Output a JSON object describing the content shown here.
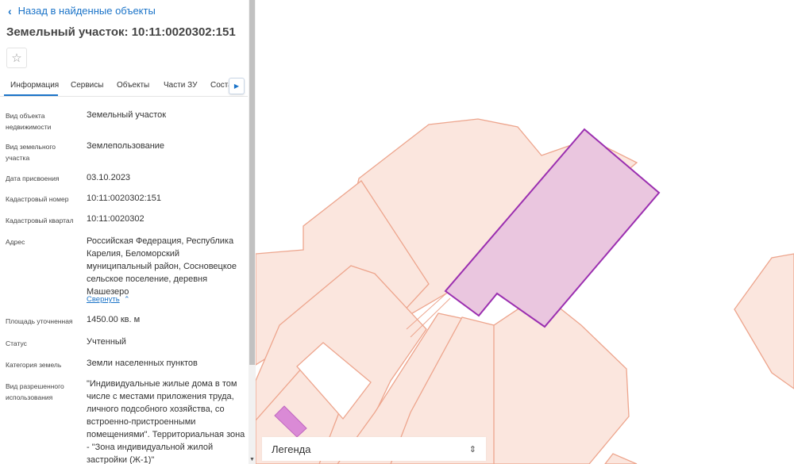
{
  "panel": {
    "back_label": "Назад в найденные объекты",
    "title": "Земельный участок: 10:11:0020302:151",
    "tabs": [
      {
        "label": "Информация"
      },
      {
        "label": "Сервисы"
      },
      {
        "label": "Объекты"
      },
      {
        "label": "Части ЗУ"
      },
      {
        "label": "Соста"
      }
    ],
    "collapse_label": "Свернуть",
    "rows": [
      {
        "label": "Вид объекта недвижимости",
        "value": "Земельный участок"
      },
      {
        "label": "Вид земельного участка",
        "value": "Землепользование"
      },
      {
        "label": "Дата присвоения",
        "value": "03.10.2023"
      },
      {
        "label": "Кадастровый номер",
        "value": "10:11:0020302:151"
      },
      {
        "label": "Кадастровый квартал",
        "value": "10:11:0020302"
      },
      {
        "label": "Адрес",
        "value": "Российская Федерация, Республика Карелия, Беломорский муниципальный район, Сосновецкое сельское поселение, деревня Машезеро"
      },
      {
        "label": "Площадь уточненная",
        "value": "1450.00 кв. м"
      },
      {
        "label": "Статус",
        "value": "Учтенный"
      },
      {
        "label": "Категория земель",
        "value": "Земли населенных пунктов"
      },
      {
        "label": "Вид разрешенного использования",
        "value": "\"Индивидуальные жилые дома в том числе с местами приложения труда, личного подсобного хозяйства, со встроенно-пристроенными помещениями\". Территориальная зона - \"Зона индивидуальной жилой застройки (Ж-1)\""
      }
    ]
  },
  "map": {
    "legend_label": "Легенда"
  },
  "icons": {
    "back": "chevron-left-icon",
    "star": "star-outline-icon",
    "tab_scroll": "caret-right-icon",
    "collapse": "chevron-up-icon",
    "legend_toggle": "sort-arrows-icon"
  },
  "colors": {
    "accent": "#1a73c8",
    "parcel_fill": "#fbe6de",
    "parcel_stroke": "#eda58d",
    "selected_fill": "#eac6df",
    "selected_stroke": "#9b2fb0",
    "small_parcel": "#da8ad6"
  }
}
